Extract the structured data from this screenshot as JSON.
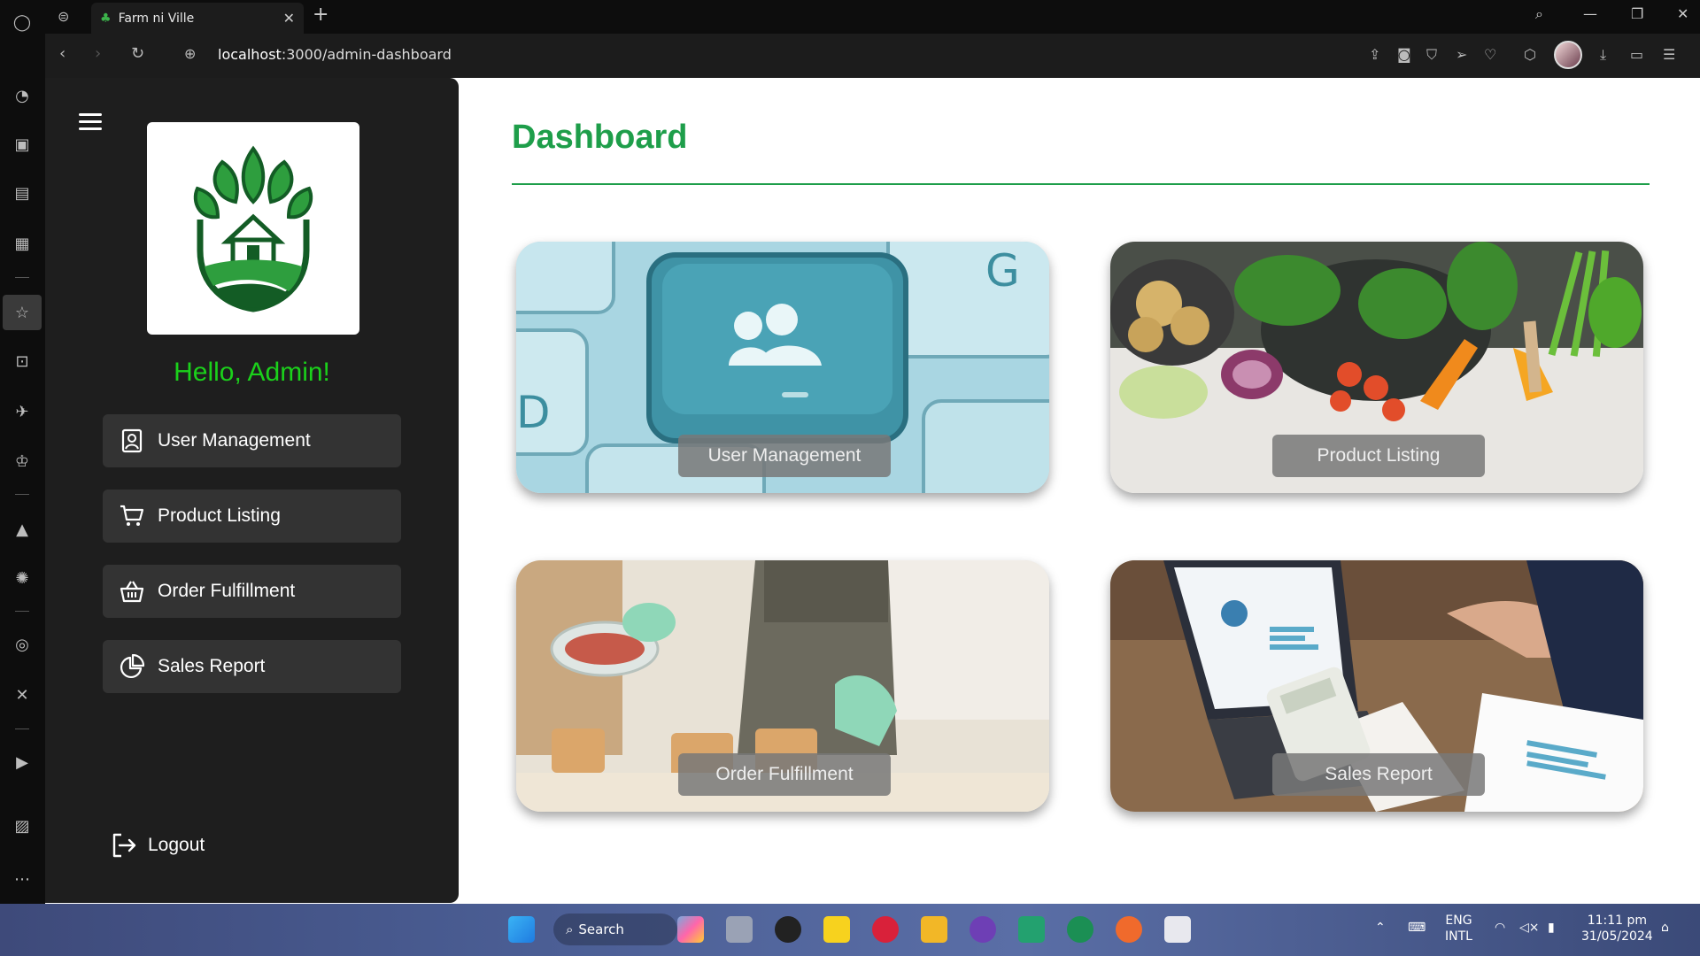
{
  "browser": {
    "tab_title": "Farm ni Ville",
    "url_host": "localhost",
    "url_rest": ":3000/admin-dashboard"
  },
  "sidebar": {
    "greeting": "Hello, Admin!",
    "nav": [
      {
        "label": "User Management",
        "icon": "user-badge-icon"
      },
      {
        "label": "Product Listing",
        "icon": "cart-icon"
      },
      {
        "label": "Order Fulfillment",
        "icon": "basket-icon"
      },
      {
        "label": "Sales Report",
        "icon": "pie-chart-icon"
      }
    ],
    "logout_label": "Logout"
  },
  "main": {
    "title": "Dashboard",
    "cards": [
      {
        "label": "User Management",
        "image": "keyboard-users-key"
      },
      {
        "label": "Product Listing",
        "image": "fresh-vegetables"
      },
      {
        "label": "Order Fulfillment",
        "image": "food-packing"
      },
      {
        "label": "Sales Report",
        "image": "laptop-calculator-charts"
      }
    ]
  },
  "taskbar": {
    "search_label": "Search",
    "lang_top": "ENG",
    "lang_bottom": "INTL",
    "time": "11:11 pm",
    "date": "31/05/2024"
  },
  "colors": {
    "brand_green": "#1e9e4a",
    "greeting_green": "#1bd11b",
    "sidebar_bg": "#1e1e1e",
    "nav_item_bg": "#333333"
  }
}
